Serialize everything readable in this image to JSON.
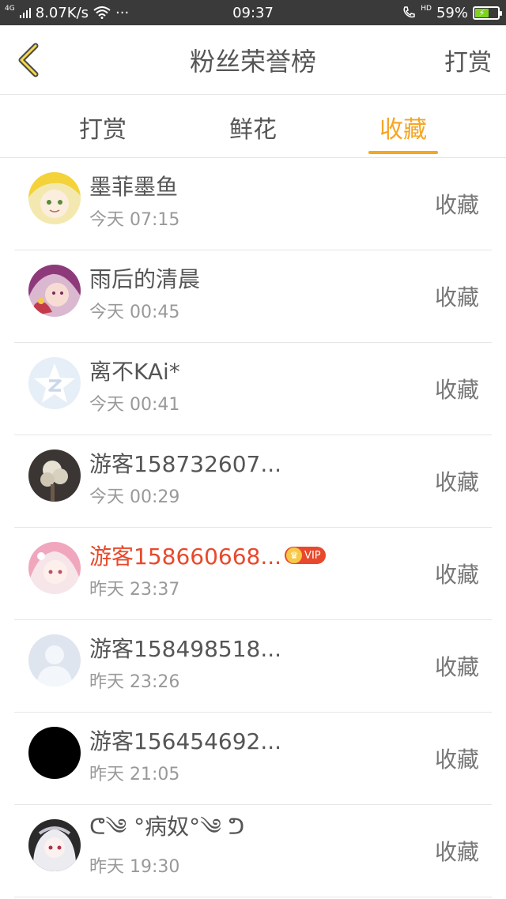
{
  "status_bar": {
    "network_tag": "4G",
    "network_speed": "8.07K/s",
    "more": "···",
    "time": "09:37",
    "hd_tag": "HD",
    "battery_percent": "59%",
    "battery_level": 0.59,
    "battery_color": "#7ed321"
  },
  "header": {
    "back_icon": "chevron-left-icon",
    "title": "粉丝荣誉榜",
    "action_label": "打赏"
  },
  "tabs": [
    {
      "label": "打赏",
      "active": false
    },
    {
      "label": "鲜花",
      "active": false
    },
    {
      "label": "收藏",
      "active": true
    }
  ],
  "accent_color": "#f5a623",
  "vip_color": "#e8492c",
  "list": [
    {
      "name": "墨菲墨鱼",
      "time": "今天 07:15",
      "action": "收藏",
      "vip": false
    },
    {
      "name": "雨后的清晨",
      "time": "今天 00:45",
      "action": "收藏",
      "vip": false
    },
    {
      "name": "离不KAi*",
      "time": "今天 00:41",
      "action": "收藏",
      "vip": false
    },
    {
      "name": "游客158732607...",
      "time": "今天 00:29",
      "action": "收藏",
      "vip": false
    },
    {
      "name": "游客158660668...",
      "time": "昨天 23:37",
      "action": "收藏",
      "vip": true,
      "badge": "VIP"
    },
    {
      "name": "游客158498518...",
      "time": "昨天 23:26",
      "action": "收藏",
      "vip": false
    },
    {
      "name": "游客156454692...",
      "time": "昨天 21:05",
      "action": "收藏",
      "vip": false
    },
    {
      "name": "ᕦ༄ °病奴°༄ ᕤ",
      "time": "昨天 19:30",
      "action": "收藏",
      "vip": false
    }
  ]
}
